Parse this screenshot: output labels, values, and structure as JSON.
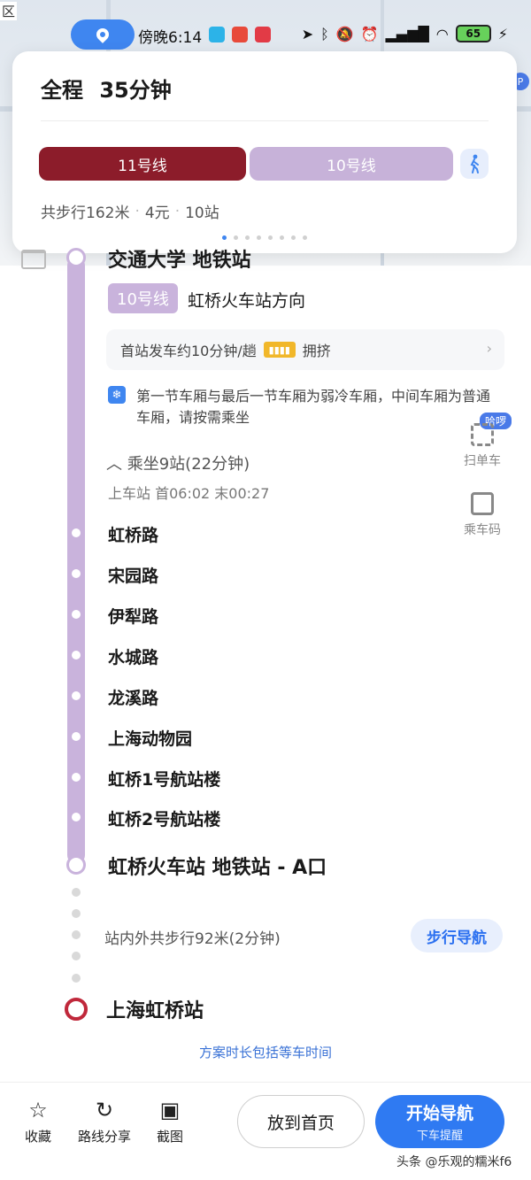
{
  "map": {
    "corner_label": "区"
  },
  "status_bar": {
    "time": "傍晚6:14",
    "network": "…",
    "battery": "65",
    "lightning": "⚡"
  },
  "summary": {
    "total_label": "全程",
    "total_time": "35分钟",
    "segments": [
      {
        "label": "11号线",
        "color": "#8c1c2a"
      },
      {
        "label": "10号线",
        "color": "#c7b2d9"
      }
    ],
    "walk_distance": "共步行162米",
    "fare": "4元",
    "stations": "10站",
    "page_count": 8,
    "active_page": 0
  },
  "route": {
    "board_station": "交通大学 地铁站",
    "line_badge": "10号线",
    "direction": "虹桥火车站方向",
    "frequency": "首站发车约10分钟/趟",
    "crowd_level": "拥挤",
    "car_note": "第一节车厢与最后一节车厢为弱冷车厢，中间车厢为普通车厢，请按需乘坐",
    "ride_count": "︿ 乘坐9站(22分钟)",
    "board_times": "上车站 首06:02  末00:27",
    "stops": [
      "虹桥路",
      "宋园路",
      "伊犁路",
      "水城路",
      "龙溪路",
      "上海动物园",
      "虹桥1号航站楼",
      "虹桥2号航站楼"
    ],
    "alight_station": "虹桥火车站 地铁站 - A口",
    "walk_text": "站内外共步行92米(2分钟)",
    "walk_nav_label": "步行导航",
    "destination": "上海虹桥站",
    "footnote": "方案时长包括等车时间"
  },
  "side_tools": {
    "scan_badge": "哈啰",
    "scan_label": "扫单车",
    "qr_label": "乘车码"
  },
  "bottom_bar": {
    "favorite": "收藏",
    "share": "路线分享",
    "screenshot": "截图",
    "home": "放到首页",
    "start_nav": "开始导航",
    "alight_reminder": "下车提醒"
  },
  "watermark": "头条 @乐观的糯米f6",
  "colors": {
    "line11": "#8c1c2a",
    "line10": "#c9b3dc",
    "accent_blue": "#2f7af2",
    "destination_red": "#c0283b"
  }
}
